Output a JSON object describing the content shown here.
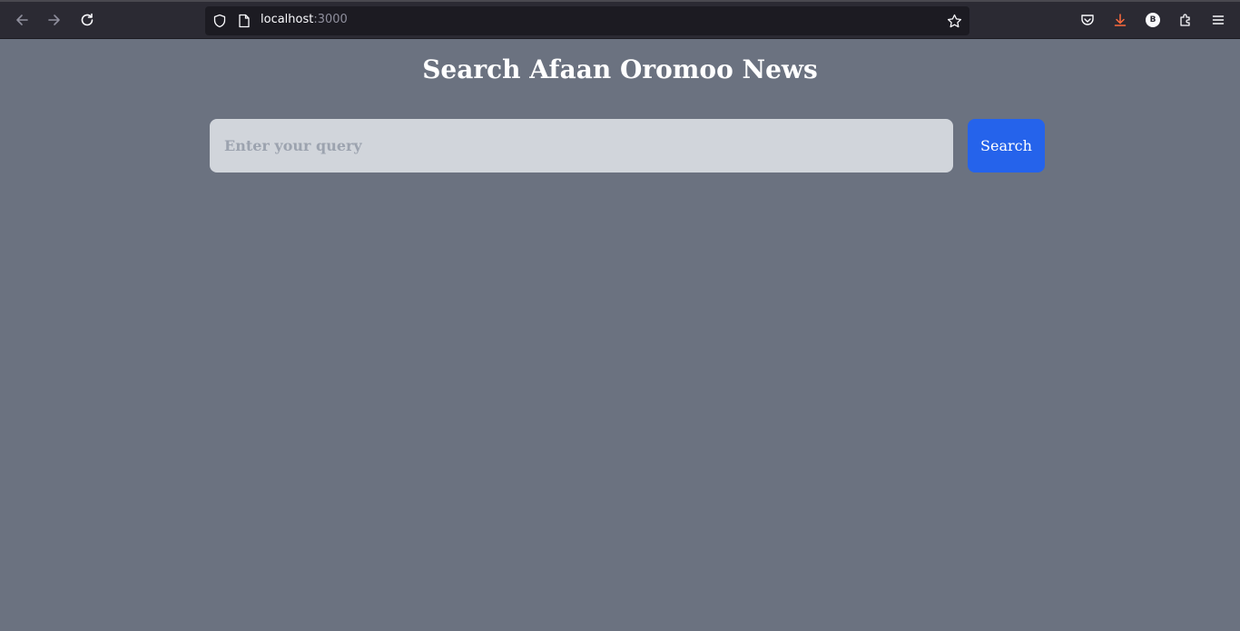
{
  "browser": {
    "url_host": "localhost",
    "url_port": ":3000",
    "profile_initial": "B",
    "icons": {
      "back": "arrow-left-icon",
      "forward": "arrow-right-icon",
      "reload": "reload-icon",
      "shield": "shield-icon",
      "page": "page-icon",
      "bookmark": "star-icon",
      "pocket": "pocket-icon",
      "downloads": "download-icon",
      "extensions": "puzzle-icon",
      "menu": "hamburger-menu-icon"
    },
    "download_icon_color": "#ff6a3d"
  },
  "page": {
    "title": "Search Afaan Oromoo News",
    "search": {
      "placeholder": "Enter your query",
      "value": "",
      "button_label": "Search"
    },
    "colors": {
      "background": "#6b7280",
      "input_background": "#d1d5db",
      "button": "#2563eb"
    }
  }
}
